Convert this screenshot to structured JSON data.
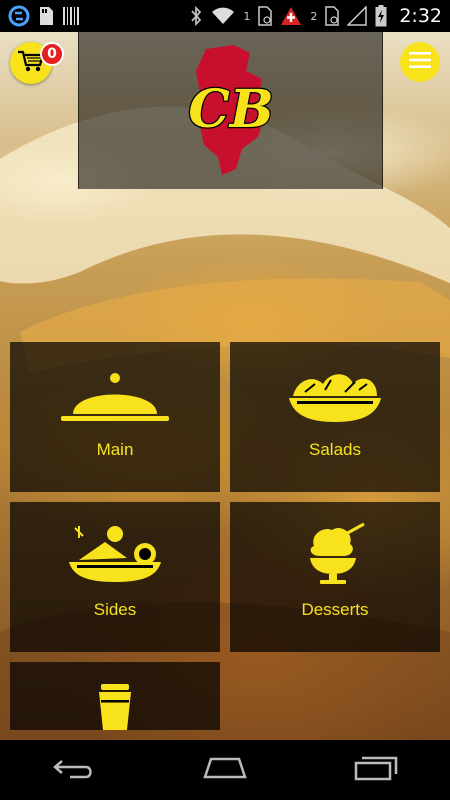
{
  "status_bar": {
    "sim1": "1",
    "sim2": "2",
    "time": "2:32"
  },
  "header": {
    "logo_text": "CB",
    "cart_count": "0",
    "accent_color": "#f7e21c",
    "badge_color": "#e42020"
  },
  "categories": [
    {
      "label": "Main",
      "icon": "cloche-icon"
    },
    {
      "label": "Salads",
      "icon": "salad-bowl-icon"
    },
    {
      "label": "Sides",
      "icon": "side-plate-icon"
    },
    {
      "label": "Desserts",
      "icon": "ice-cream-icon"
    },
    {
      "label": "",
      "icon": "drink-cup-icon"
    }
  ],
  "nav_bar": {
    "buttons": [
      "back-icon",
      "home-icon",
      "recent-apps-icon"
    ]
  }
}
